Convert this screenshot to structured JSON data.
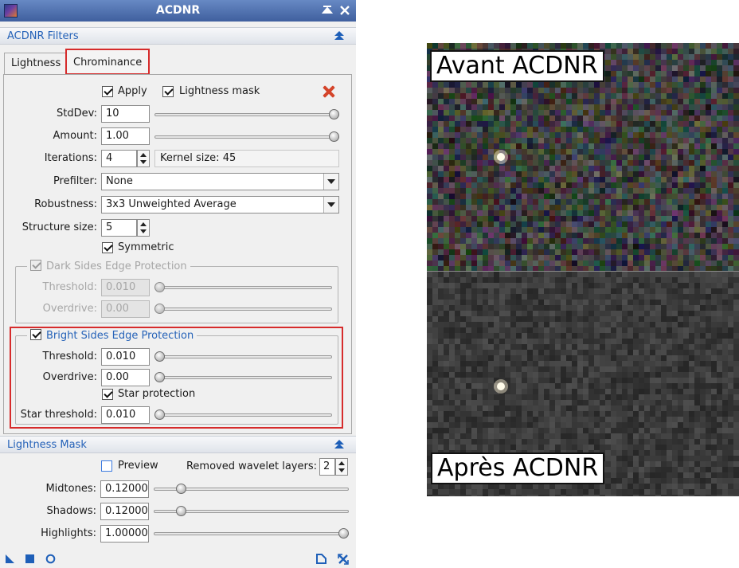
{
  "window": {
    "title": "ACDNR"
  },
  "filters_section": {
    "title": "ACDNR Filters"
  },
  "tabs": [
    {
      "label": "Lightness"
    },
    {
      "label": "Chrominance"
    }
  ],
  "chrominance": {
    "apply": {
      "label": "Apply",
      "checked": true
    },
    "lightness_mask": {
      "label": "Lightness mask",
      "checked": true
    },
    "stddev": {
      "label": "StdDev:",
      "value": "10",
      "slider_fraction": 1.0
    },
    "amount": {
      "label": "Amount:",
      "value": "1.00",
      "slider_fraction": 1.0
    },
    "iterations": {
      "label": "Iterations:",
      "value": "4"
    },
    "kernel_size": "Kernel size: 45",
    "prefilter": {
      "label": "Prefilter:",
      "value": "None"
    },
    "robustness": {
      "label": "Robustness:",
      "value": "3x3 Unweighted Average"
    },
    "structure_size": {
      "label": "Structure size:",
      "value": "5"
    },
    "symmetric": {
      "label": "Symmetric",
      "checked": true
    },
    "dark_sides": {
      "title": "Dark Sides Edge Protection",
      "enabled": false,
      "checked": true,
      "threshold": {
        "label": "Threshold:",
        "value": "0.010",
        "slider_fraction": 0.0
      },
      "overdrive": {
        "label": "Overdrive:",
        "value": "0.00",
        "slider_fraction": 0.0
      }
    },
    "bright_sides": {
      "title": "Bright Sides Edge Protection",
      "checked": true,
      "threshold": {
        "label": "Threshold:",
        "value": "0.010",
        "slider_fraction": 0.0
      },
      "overdrive": {
        "label": "Overdrive:",
        "value": "0.00",
        "slider_fraction": 0.0
      },
      "star_protection": {
        "label": "Star protection",
        "checked": true
      },
      "star_threshold": {
        "label": "Star threshold:",
        "value": "0.010",
        "slider_fraction": 0.0
      }
    }
  },
  "lightness_mask_section": {
    "title": "Lightness Mask",
    "preview": {
      "label": "Preview",
      "checked": false
    },
    "removed_wavelet_layers": {
      "label": "Removed wavelet layers:",
      "value": "2"
    },
    "midtones": {
      "label": "Midtones:",
      "value": "0.12000",
      "slider_fraction": 0.12
    },
    "shadows": {
      "label": "Shadows:",
      "value": "0.12000",
      "slider_fraction": 0.12
    },
    "highlights": {
      "label": "Highlights:",
      "value": "1.00000",
      "slider_fraction": 1.0
    }
  },
  "comparison": {
    "before_label": "Avant ACDNR",
    "after_label": "Après ACDNR"
  },
  "colors": {
    "accent": "#2562b8",
    "highlight_border": "#d62b2b",
    "title_bar": "#4a6aa8"
  }
}
